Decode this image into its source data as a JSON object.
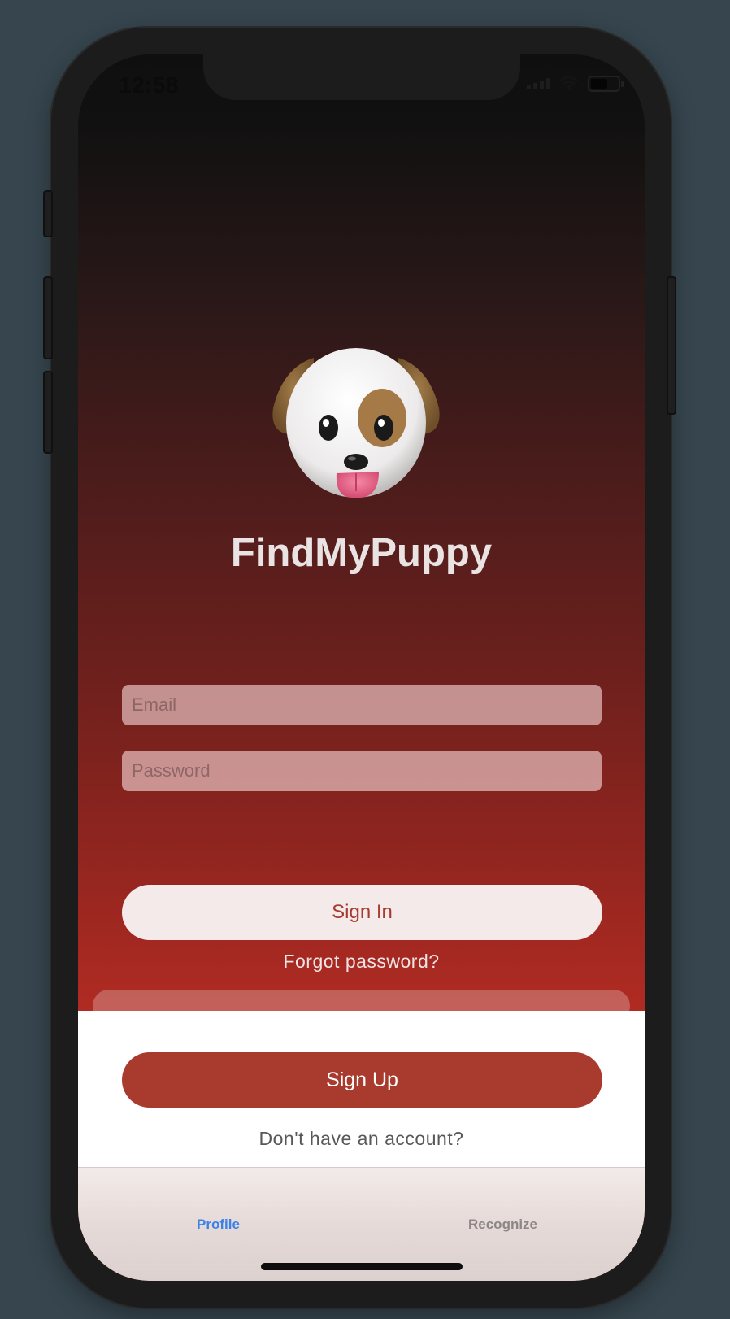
{
  "status_bar": {
    "time": "12:58"
  },
  "app": {
    "title": "FindMyPuppy",
    "logo": "dog-face-icon"
  },
  "form": {
    "email_placeholder": "Email",
    "password_placeholder": "Password"
  },
  "actions": {
    "sign_in_label": "Sign In",
    "forgot_label": "Forgot password?",
    "sign_up_label": "Sign Up",
    "no_account_label": "Don't have an account?"
  },
  "tabs": [
    {
      "label": "Profile",
      "active": true
    },
    {
      "label": "Recognize",
      "active": false
    }
  ],
  "colors": {
    "accent": "#a93a2e",
    "tab_active": "#3a82e8",
    "tab_inactive": "#8c8786"
  }
}
